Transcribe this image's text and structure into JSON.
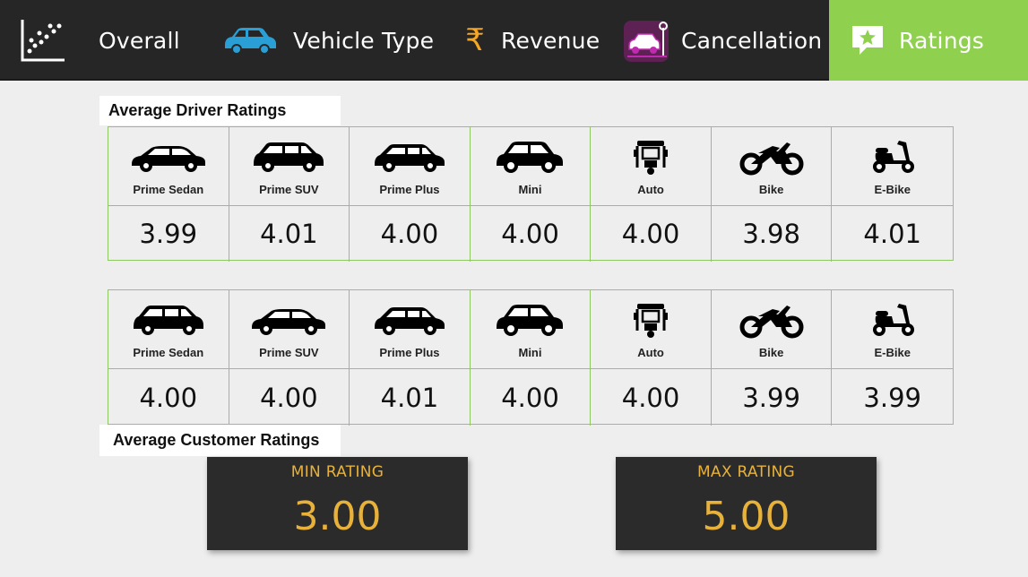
{
  "nav": {
    "items": [
      {
        "label": "Overall",
        "icon": "scatter-chart-icon"
      },
      {
        "label": "Vehicle Type",
        "icon": "car-icon"
      },
      {
        "label": "Revenue",
        "icon": "rupee-icon"
      },
      {
        "label": "Cancellation",
        "icon": "car-parking-icon"
      },
      {
        "label": "Ratings",
        "icon": "star-chat-icon"
      }
    ],
    "active": "Ratings",
    "active_color": "#8fd14f"
  },
  "driver": {
    "title": "Average Driver Ratings",
    "vehicles": [
      "Prime Sedan",
      "Prime SUV",
      "Prime Plus",
      "Mini",
      "Auto",
      "Bike",
      "E-Bike"
    ],
    "values": [
      "3.99",
      "4.01",
      "4.00",
      "4.00",
      "4.00",
      "3.98",
      "4.01"
    ]
  },
  "customer": {
    "title": "Average Customer Ratings",
    "vehicles": [
      "Prime Sedan",
      "Prime SUV",
      "Prime Plus",
      "Mini",
      "Auto",
      "Bike",
      "E-Bike"
    ],
    "values": [
      "4.00",
      "4.00",
      "4.01",
      "4.00",
      "4.00",
      "3.99",
      "3.99"
    ]
  },
  "kpis": {
    "min": {
      "label": "MIN RATING",
      "value": "3.00"
    },
    "max": {
      "label": "MAX RATING",
      "value": "5.00"
    },
    "accent": "#e8b23a"
  }
}
